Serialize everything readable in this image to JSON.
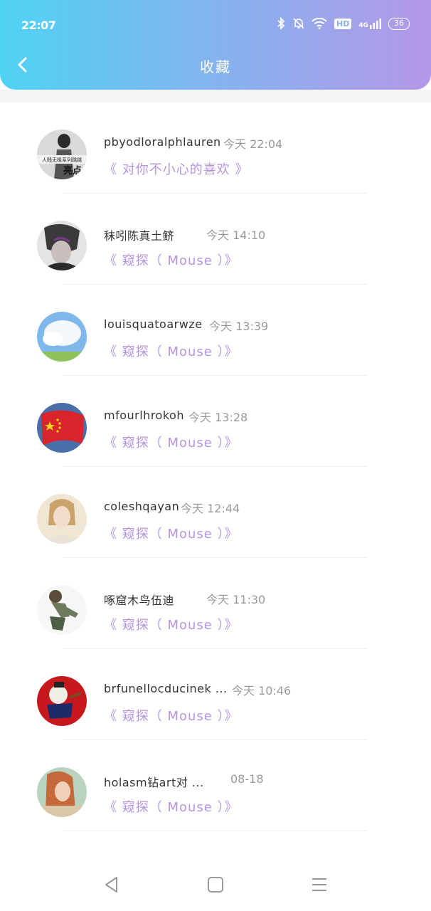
{
  "status_bar": {
    "time": "22:07",
    "hd": "HD",
    "network": "4G",
    "battery": "36"
  },
  "header": {
    "title": "收藏"
  },
  "items": [
    {
      "name": "pbyodloralphlauren",
      "time": "今天 22:04",
      "title": "《 对你不小心的喜欢 》",
      "avatar_text": "亮点",
      "avatar_caption": "人贱无极系列跳跳"
    },
    {
      "name": "秣吲陈真土鲚",
      "time": "今天 14:10",
      "title": "《 窥探（ Mouse ）》"
    },
    {
      "name": "louisquatoarwze",
      "time": "今天 13:39",
      "title": "《 窥探（ Mouse ）》"
    },
    {
      "name": "mfourlhrokoh",
      "time": "今天 13:28",
      "title": "《 窥探（ Mouse ）》"
    },
    {
      "name": "coleshqayan",
      "time": "今天 12:44",
      "title": "《 窥探（ Mouse ）》"
    },
    {
      "name": "啄窟木鸟伍迪",
      "time": "今天 11:30",
      "title": "《 窥探（ Mouse ）》"
    },
    {
      "name": "brfunellocducinek ...",
      "time": "今天 10:46",
      "title": "《 窥探（ Mouse ）》"
    },
    {
      "name": "holasm钻art对 ...",
      "time": "08-18",
      "title": "《 窥探（ Mouse ）》"
    }
  ],
  "accent_color": "#b594e3",
  "header_gradient": [
    "#4fd3f5",
    "#b497e8"
  ]
}
